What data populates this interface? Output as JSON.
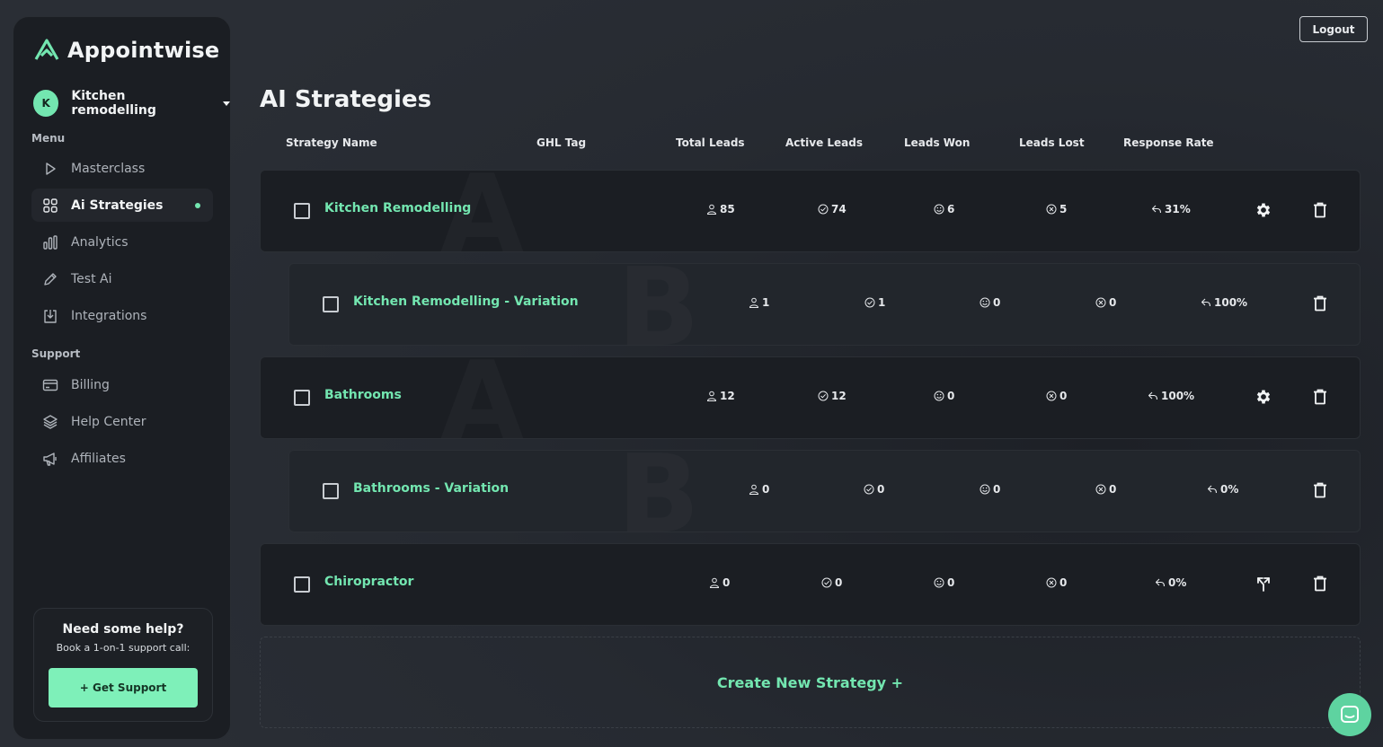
{
  "app": {
    "name": "Appointwise"
  },
  "account": {
    "initial": "K",
    "name": "Kitchen remodelling"
  },
  "sidebar": {
    "menu_label": "Menu",
    "menu_items": [
      {
        "label": "Masterclass",
        "icon": "play-icon"
      },
      {
        "label": "Ai Strategies",
        "icon": "grid-icon",
        "active": true
      },
      {
        "label": "Analytics",
        "icon": "bar-chart-icon"
      },
      {
        "label": "Test Ai",
        "icon": "pencil-icon"
      },
      {
        "label": "Integrations",
        "icon": "download-icon"
      }
    ],
    "support_label": "Support",
    "support_items": [
      {
        "label": "Billing",
        "icon": "credit-card-icon"
      },
      {
        "label": "Help Center",
        "icon": "layers-icon"
      },
      {
        "label": "Affiliates",
        "icon": "megaphone-icon"
      }
    ],
    "help_card": {
      "title": "Need some help?",
      "subtitle": "Book a 1-on-1 support call:",
      "button": "+ Get Support"
    }
  },
  "header": {
    "logout": "Logout"
  },
  "page": {
    "title": "AI Strategies"
  },
  "table": {
    "columns": [
      "Strategy Name",
      "GHL Tag",
      "Total Leads",
      "Active Leads",
      "Leads Won",
      "Leads Lost",
      "Response Rate"
    ],
    "rows": [
      {
        "name": "Kitchen Remodelling",
        "variation": false,
        "watermark": "A",
        "total": "85",
        "active": "74",
        "won": "6",
        "lost": "5",
        "rate": "31%",
        "action": "gear-icon"
      },
      {
        "name": "Kitchen Remodelling - Variation",
        "variation": true,
        "watermark": "B",
        "total": "1",
        "active": "1",
        "won": "0",
        "lost": "0",
        "rate": "100%",
        "action": ""
      },
      {
        "name": "Bathrooms",
        "variation": false,
        "watermark": "A",
        "total": "12",
        "active": "12",
        "won": "0",
        "lost": "0",
        "rate": "100%",
        "action": "gear-icon"
      },
      {
        "name": "Bathrooms - Variation",
        "variation": true,
        "watermark": "B",
        "total": "0",
        "active": "0",
        "won": "0",
        "lost": "0",
        "rate": "0%",
        "action": ""
      },
      {
        "name": "Chiropractor",
        "variation": false,
        "watermark": "",
        "total": "0",
        "active": "0",
        "won": "0",
        "lost": "0",
        "rate": "0%",
        "action": "split-icon"
      }
    ]
  },
  "create_label": "Create New Strategy +",
  "colors": {
    "accent": "#73e6b0",
    "button": "#7ef0b9",
    "panel": "#1b1e23"
  }
}
